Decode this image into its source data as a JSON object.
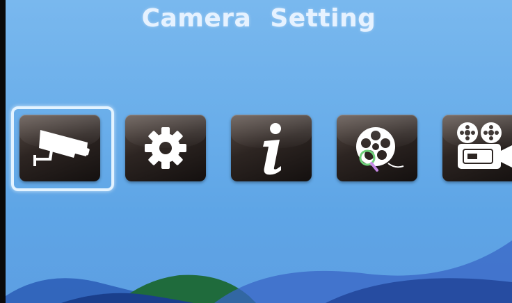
{
  "header": {
    "title": "Camera Setting"
  },
  "menu": {
    "selected_index": 0,
    "items": [
      {
        "icon": "security-camera-icon"
      },
      {
        "icon": "gear-icon"
      },
      {
        "icon": "info-icon"
      },
      {
        "icon": "film-reel-search-icon"
      },
      {
        "icon": "movie-camera-icon"
      }
    ]
  },
  "colors": {
    "background_top": "#79b8ee",
    "background_bottom": "#5d9fe2",
    "tile": "#2d2522",
    "selection": "#e3f3ff",
    "glyph": "#ffffff"
  }
}
